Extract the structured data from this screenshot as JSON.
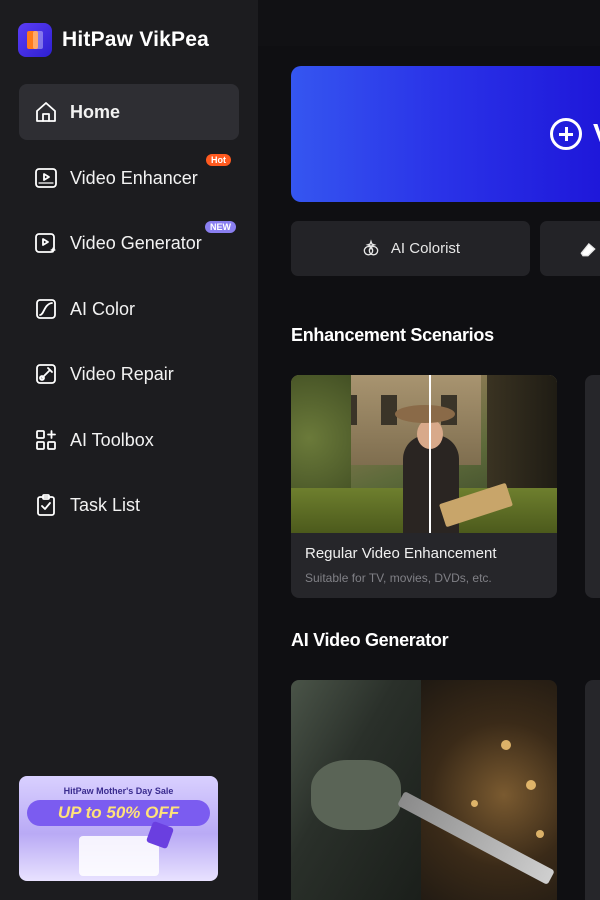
{
  "app": {
    "name": "HitPaw VikPea"
  },
  "sidebar": {
    "items": [
      {
        "label": "Home",
        "icon": "home-icon",
        "active": true
      },
      {
        "label": "Video Enhancer",
        "icon": "uhd-video-icon",
        "badge": "Hot"
      },
      {
        "label": "Video Generator",
        "icon": "video-sparkle-icon",
        "badge": "NEW"
      },
      {
        "label": "AI Color",
        "icon": "color-curve-icon"
      },
      {
        "label": "Video Repair",
        "icon": "repair-icon"
      },
      {
        "label": "AI Toolbox",
        "icon": "toolbox-icon"
      },
      {
        "label": "Task List",
        "icon": "clipboard-check-icon"
      }
    ],
    "promo": {
      "title": "HitPaw Mother's Day Sale",
      "headline": "UP to 50% OFF"
    }
  },
  "hero": {
    "partial_text": "V",
    "icon": "plus-circle-icon"
  },
  "quick_actions": [
    {
      "label": "AI Colorist",
      "icon": "colorist-icon"
    },
    {
      "label": "",
      "icon": "eraser-icon"
    }
  ],
  "sections": {
    "enhancement": {
      "title": "Enhancement Scenarios",
      "cards": [
        {
          "title": "Regular Video Enhancement",
          "desc": "Suitable for TV, movies, DVDs, etc."
        }
      ]
    },
    "generator": {
      "title": "AI Video Generator"
    }
  },
  "colors": {
    "accent": "#2a33e8",
    "sidebar_bg": "#1c1c1f",
    "hot_badge": "#ff5a1f",
    "new_badge": "#8a7ff0"
  }
}
